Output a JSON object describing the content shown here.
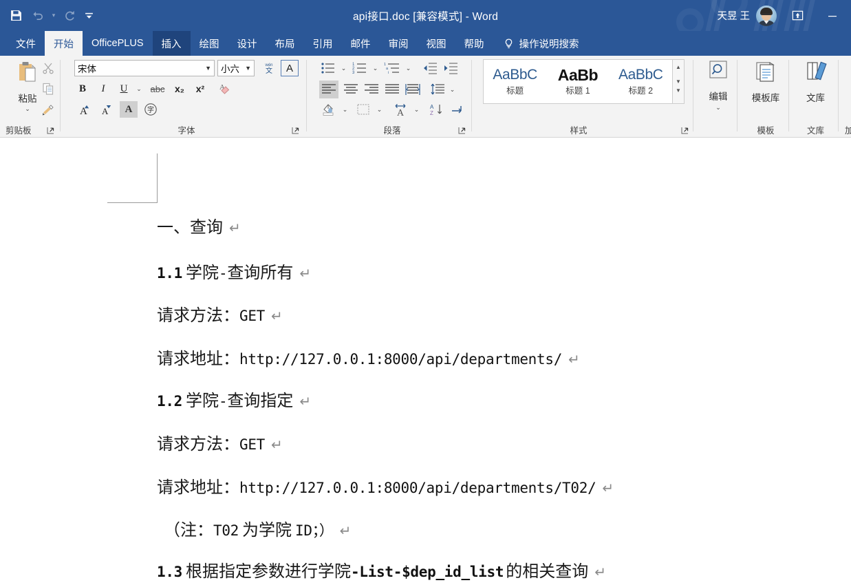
{
  "window": {
    "title": "api接口.doc [兼容模式]  -  Word",
    "account_name": "天昱 王",
    "quick_access": [
      {
        "name": "save-button",
        "icon": "save-icon",
        "label": "保存"
      },
      {
        "name": "undo-button",
        "icon": "undo-icon",
        "label": "撤消"
      },
      {
        "name": "redo-button",
        "icon": "redo-icon",
        "label": "恢复"
      },
      {
        "name": "customize-qat-button",
        "icon": "chevron-down-icon",
        "label": "自定义快速访问工具栏"
      }
    ],
    "ribbon_display_label": "功能区显示选项",
    "minimize_label": "最小化"
  },
  "tabs": [
    {
      "label": "文件",
      "state": "normal"
    },
    {
      "label": "开始",
      "state": "active"
    },
    {
      "label": "OfficePLUS",
      "state": "normal"
    },
    {
      "label": "插入",
      "state": "hover"
    },
    {
      "label": "绘图",
      "state": "normal"
    },
    {
      "label": "设计",
      "state": "normal"
    },
    {
      "label": "布局",
      "state": "normal"
    },
    {
      "label": "引用",
      "state": "normal"
    },
    {
      "label": "邮件",
      "state": "normal"
    },
    {
      "label": "审阅",
      "state": "normal"
    },
    {
      "label": "视图",
      "state": "normal"
    },
    {
      "label": "帮助",
      "state": "normal"
    }
  ],
  "tell_me": {
    "label": "操作说明搜索",
    "icon": "lightbulb-icon"
  },
  "ribbon": {
    "clipboard": {
      "group_label": "剪贴板",
      "paste_label": "粘贴",
      "cut_label": "剪切",
      "copy_label": "复制",
      "format_painter_label": "格式刷"
    },
    "font": {
      "group_label": "字体",
      "font_name": "宋体",
      "font_size": "小六",
      "bold": "B",
      "italic": "I",
      "underline": "U",
      "strikethrough": "abc",
      "subscript": "x₂",
      "superscript": "x²",
      "phonetic_guide": "wén 文",
      "character_border": "A",
      "clear_formatting": "清除所有格式",
      "grow_font": "A",
      "shrink_font": "A",
      "text_highlight": "A",
      "enclose_characters": "字"
    },
    "paragraph": {
      "group_label": "段落",
      "bullets": "项目符号",
      "numbering": "编号",
      "multilevel": "多级列表",
      "decrease_indent": "减少缩进量",
      "increase_indent": "增加缩进量",
      "align_left": "左对齐",
      "align_center": "居中",
      "align_right": "右对齐",
      "justify": "两端对齐",
      "distributed": "分散对齐",
      "line_spacing": "行和段落间距",
      "shading": "底纹",
      "borders": "边框",
      "text_effect": "中文版式",
      "sort": "排序",
      "show_marks": "显示编辑标记"
    },
    "styles": {
      "group_label": "样式",
      "items": [
        {
          "sample": "AaBbC",
          "name": "标题",
          "variant": "title"
        },
        {
          "sample": "AaBb",
          "name": "标题 1",
          "variant": "h1"
        },
        {
          "sample": "AaBbC",
          "name": "标题 2",
          "variant": "h2"
        }
      ],
      "scroll_up": "▲",
      "scroll_down": "▼",
      "more": "▼"
    },
    "editing": {
      "label": "编辑",
      "icon": "search-icon"
    },
    "template": {
      "group_label": "模板",
      "label": "模板库",
      "icon": "template-icon"
    },
    "library": {
      "group_label": "文库",
      "label": "文库",
      "icon": "books-icon"
    },
    "dialog_launcher": "对话框启动器"
  },
  "document": {
    "lines": [
      {
        "type": "heading",
        "zh": "一、查询",
        "mono": "",
        "zh2": "",
        "pilcrow": "↵"
      },
      {
        "type": "sub",
        "mono": "1.1",
        "zh": "学院",
        "mono2": "-",
        "zh2": "查询所有",
        "pilcrow": "↵"
      },
      {
        "type": "body",
        "zh": "请求方法：",
        "mono": "GET",
        "pilcrow": "↵"
      },
      {
        "type": "body",
        "zh": "请求地址：",
        "mono": "http://127.0.0.1:8000/api/departments/",
        "pilcrow": "↵"
      },
      {
        "type": "sub",
        "mono": "1.2",
        "zh": "学院",
        "mono2": "-",
        "zh2": "查询指定",
        "pilcrow": "↵"
      },
      {
        "type": "body",
        "zh": "请求方法：",
        "mono": "GET",
        "pilcrow": "↵"
      },
      {
        "type": "body",
        "zh": "请求地址：",
        "mono": "http://127.0.0.1:8000/api/departments/T02/",
        "pilcrow": "↵"
      },
      {
        "type": "note",
        "zh": "（注：",
        "mono": "T02",
        "zh2": "为学院",
        "mono2": "ID；）",
        "pilcrow": "↵"
      },
      {
        "type": "sub",
        "mono": "1.3",
        "zh": "根据指定参数进行学院",
        "mono2": "-List-$dep_id_list",
        "zh2": "的相关查询",
        "pilcrow": "↵"
      }
    ]
  },
  "colors": {
    "titlebar": "#2b5797",
    "ribbon_bg": "#f3f3f3",
    "accent_blue": "#2e5b8f",
    "page_bg": "#ffffff"
  }
}
